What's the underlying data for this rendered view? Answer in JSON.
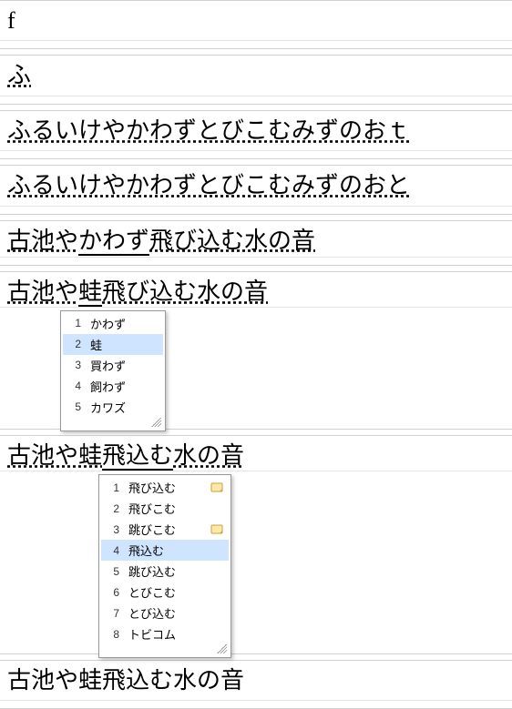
{
  "rows": {
    "r1": {
      "text": "f",
      "has_caret": true
    },
    "r2": {
      "text": "ふ",
      "has_caret": true
    },
    "r3": {
      "text": "ふるいけやかわずとびこむみずのおｔ",
      "has_caret": true
    },
    "r4": {
      "text": "ふるいけやかわずとびこむみずのおと",
      "has_caret": true
    },
    "r5": {
      "segments": [
        {
          "text": "古池や",
          "style": "dotted"
        },
        {
          "text": "かわず",
          "style": "thick"
        },
        {
          "text": "飛び込む水の音",
          "style": "dotted"
        }
      ],
      "has_caret": false
    },
    "r6": {
      "segments": [
        {
          "text": "古池や",
          "style": "dotted"
        },
        {
          "text": "蛙",
          "style": "thick"
        },
        {
          "text": "飛び込む水の音",
          "style": "dotted"
        }
      ],
      "has_caret": false
    },
    "r7": {
      "segments": [
        {
          "text": "古池や蛙",
          "style": "dotted"
        },
        {
          "text": "飛込む",
          "style": "thick"
        },
        {
          "text": "水の音",
          "style": "dotted"
        }
      ],
      "has_caret": false
    },
    "r8": {
      "text": "古池や蛙飛込む水の音",
      "has_caret": true
    }
  },
  "dropdowns": {
    "d1": {
      "selected_index": 2,
      "items": [
        {
          "n": "1",
          "label": "かわず",
          "note": false
        },
        {
          "n": "2",
          "label": "蛙",
          "note": false
        },
        {
          "n": "3",
          "label": "買わず",
          "note": false
        },
        {
          "n": "4",
          "label": "飼わず",
          "note": false
        },
        {
          "n": "5",
          "label": "カワズ",
          "note": false
        }
      ]
    },
    "d2": {
      "selected_index": 4,
      "items": [
        {
          "n": "1",
          "label": "飛び込む",
          "note": true
        },
        {
          "n": "2",
          "label": "飛びこむ",
          "note": false
        },
        {
          "n": "3",
          "label": "跳びこむ",
          "note": true
        },
        {
          "n": "4",
          "label": "飛込む",
          "note": false
        },
        {
          "n": "5",
          "label": "跳び込む",
          "note": false
        },
        {
          "n": "6",
          "label": "とびこむ",
          "note": false
        },
        {
          "n": "7",
          "label": "とび込む",
          "note": false
        },
        {
          "n": "8",
          "label": "トビコム",
          "note": false
        }
      ]
    }
  }
}
